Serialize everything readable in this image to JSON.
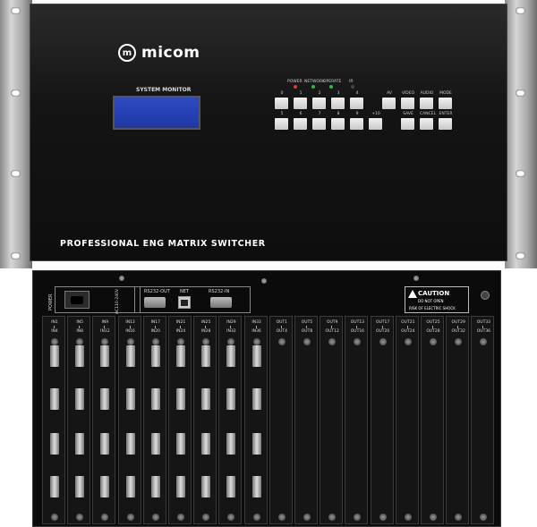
{
  "front_panel": {
    "brand": "micom",
    "logo_mark": "m",
    "system_monitor_label": "SYSTEM MONITOR",
    "title": "PROFESSIONAL ENG MATRIX SWITCHER",
    "status_leds": [
      {
        "label": "POWER",
        "color": "#e03a2a"
      },
      {
        "label": "NETWORK",
        "color": "#2dbb3c"
      },
      {
        "label": "OPERATE",
        "color": "#2dbb3c"
      },
      {
        "label": "IR",
        "color": "#444444"
      }
    ],
    "keypad_top_labels": [
      "0",
      "1",
      "2",
      "3",
      "4"
    ],
    "keypad_bottom_labels": [
      "5",
      "6",
      "7",
      "8",
      "9",
      "+10"
    ],
    "function_top_labels": [
      "AV",
      "VIDEO",
      "AUDIO",
      "MODE"
    ],
    "function_bottom_labels": [
      "SAVE",
      "CANCEL",
      "ENTER"
    ]
  },
  "rear_panel": {
    "power_label": "POWER",
    "voltage_label": "AC110-240V",
    "ports": [
      {
        "label": "RS232-OUT"
      },
      {
        "label": "NET"
      },
      {
        "label": "RS232-IN"
      }
    ],
    "caution": {
      "title": "CAUTION",
      "line1": "DO NOT OPEN",
      "line2": "RISK OF ELECTRIC SHOCK"
    },
    "input_cards": [
      {
        "top": "IN1",
        "bottom": "IN4"
      },
      {
        "top": "IN5",
        "bottom": "IN8"
      },
      {
        "top": "IN9",
        "bottom": "IN12"
      },
      {
        "top": "IN13",
        "bottom": "IN16"
      },
      {
        "top": "IN17",
        "bottom": "IN20"
      },
      {
        "top": "IN21",
        "bottom": "IN24"
      },
      {
        "top": "IN25",
        "bottom": "IN28"
      },
      {
        "top": "IN29",
        "bottom": "IN32"
      },
      {
        "top": "IN33",
        "bottom": "IN36"
      }
    ],
    "output_cards": [
      {
        "top": "OUT1",
        "bottom": "OUT4"
      },
      {
        "top": "OUT5",
        "bottom": "OUT8"
      },
      {
        "top": "OUT9",
        "bottom": "OUT12"
      },
      {
        "top": "OUT13",
        "bottom": "OUT16"
      },
      {
        "top": "OUT17",
        "bottom": "OUT20"
      },
      {
        "top": "OUT21",
        "bottom": "OUT24"
      },
      {
        "top": "OUT25",
        "bottom": "OUT28"
      },
      {
        "top": "OUT29",
        "bottom": "OUT32"
      },
      {
        "top": "OUT33",
        "bottom": "OUT36"
      }
    ]
  }
}
